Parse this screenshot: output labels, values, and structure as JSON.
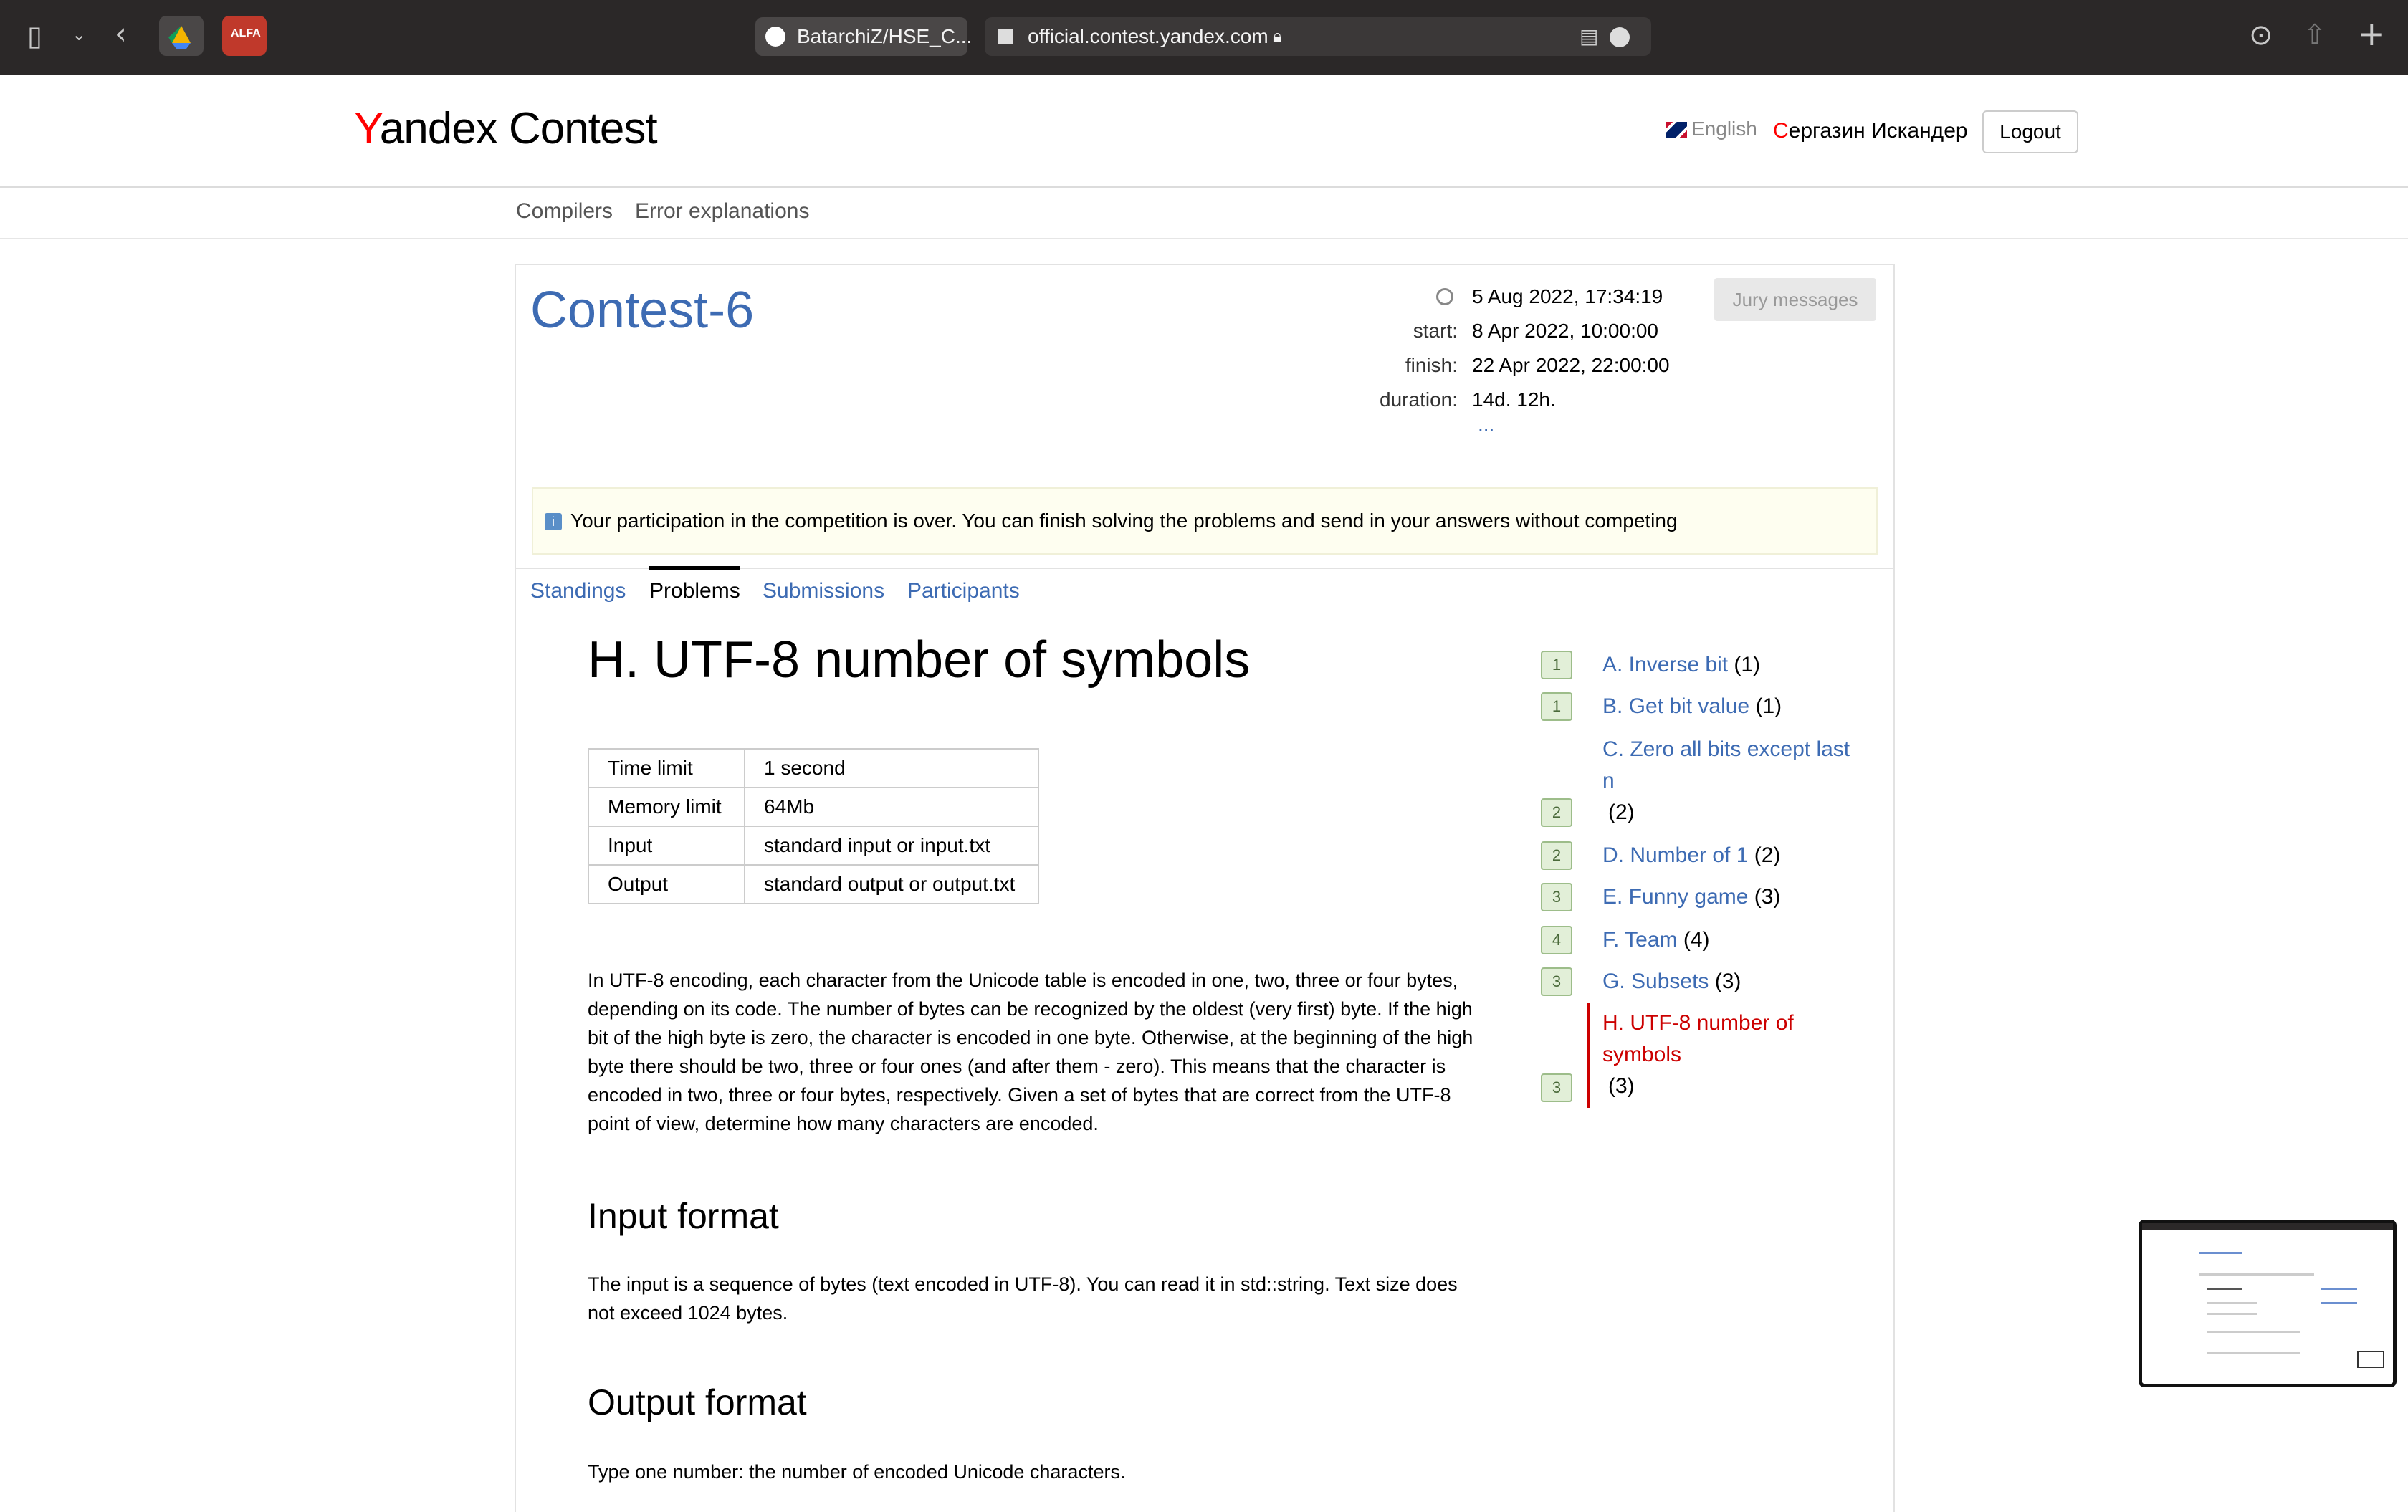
{
  "browser": {
    "tab_label": "BatarchiZ/HSE_C...",
    "address": "official.contest.yandex.com",
    "ext_alfa": "ALFA"
  },
  "header": {
    "logo_y": "Y",
    "logo_rest": "andex Contest",
    "lang": "English",
    "user_first": "С",
    "user_rest": "ергазин Искандер",
    "logout": "Logout"
  },
  "subnav": {
    "compilers": "Compilers",
    "errors": "Error explanations"
  },
  "contest": {
    "title": "Contest-6",
    "now": "5 Aug 2022, 17:34:19",
    "start_label": "start:",
    "start": "8 Apr 2022, 10:00:00",
    "finish_label": "finish:",
    "finish": "22 Apr 2022, 22:00:00",
    "duration_label": "duration:",
    "duration": "14d. 12h.",
    "more": "...",
    "jury": "Jury messages",
    "notice": "Your participation in the competition is over. You can finish solving the problems and send in your answers without competing"
  },
  "tabs": {
    "standings": "Standings",
    "problems": "Problems",
    "submissions": "Submissions",
    "participants": "Participants"
  },
  "problem": {
    "title": "H. UTF-8 number of symbols",
    "limits": [
      {
        "k": "Time limit",
        "v": "1 second"
      },
      {
        "k": "Memory limit",
        "v": "64Mb"
      },
      {
        "k": "Input",
        "v": "standard input or input.txt"
      },
      {
        "k": "Output",
        "v": "standard output or output.txt"
      }
    ],
    "statement": "In UTF-8 encoding, each character from the Unicode table is encoded in one, two, three or four bytes, depending on its code. The number of bytes can be recognized by the oldest (very first) byte. If the high bit of the high byte is zero, the character is encoded in one byte. Otherwise, at the beginning of the high byte there should be two, three or four ones (and after them - zero). This means that the character is encoded in two, three or four bytes, respectively. Given a set of bytes that are correct from the UTF-8 point of view, determine how many characters are encoded.",
    "input_h": "Input format",
    "input_text": "The input is a sequence of bytes (text encoded in UTF-8). You can read it in std::string. Text size does not exceed 1024 bytes.",
    "output_h": "Output format",
    "output_text": "Type one number: the number of encoded Unicode characters."
  },
  "problem_list": [
    {
      "badge": "1",
      "name": "A. Inverse bit",
      "count": "(1)"
    },
    {
      "badge": "1",
      "name": "B. Get bit value",
      "count": "(1)"
    },
    {
      "badge": "2",
      "name": "C. Zero all bits except last n",
      "count": "(2)"
    },
    {
      "badge": "2",
      "name": "D. Number of 1",
      "count": "(2)"
    },
    {
      "badge": "3",
      "name": "E. Funny game",
      "count": "(3)"
    },
    {
      "badge": "4",
      "name": "F. Team",
      "count": "(4)"
    },
    {
      "badge": "3",
      "name": "G. Subsets",
      "count": "(3)"
    },
    {
      "badge": "3",
      "name": "H. UTF-8 number of symbols",
      "count": "(3)"
    }
  ],
  "icons": [
    "sidebar-icon",
    "chevron-down-icon",
    "back-icon",
    "drive-icon",
    "github-icon",
    "lock-icon",
    "reader-icon",
    "more-icon",
    "download-icon",
    "share-icon",
    "plus-icon",
    "clock-icon",
    "info-icon",
    "flag-icon"
  ]
}
